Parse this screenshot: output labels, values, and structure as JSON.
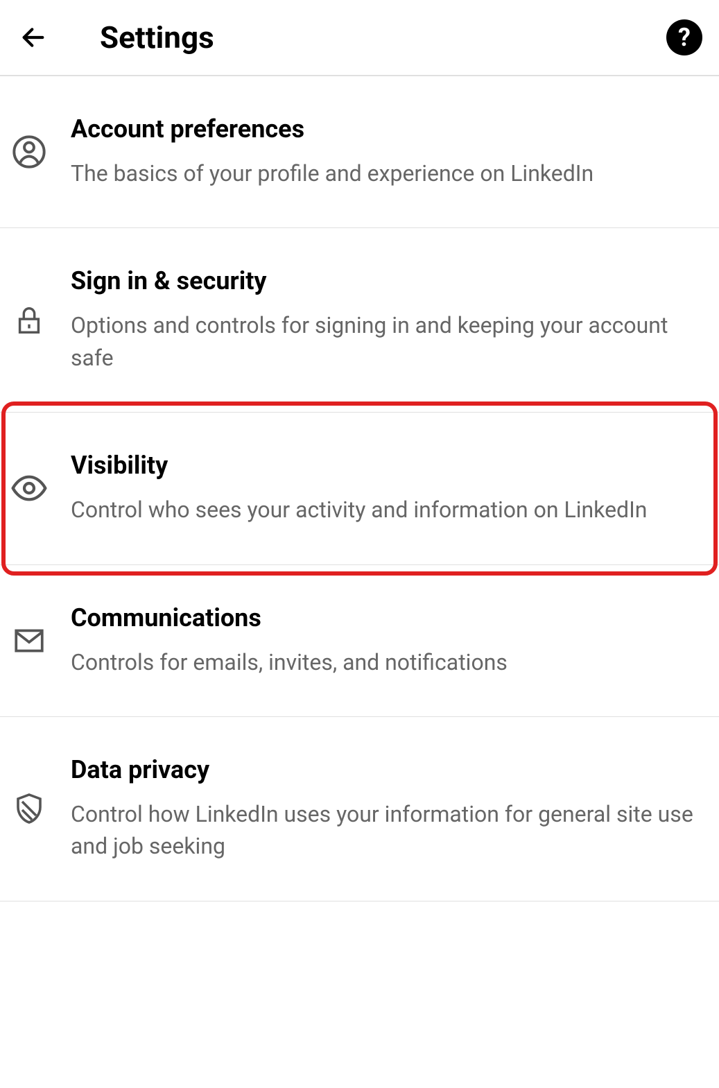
{
  "header": {
    "title": "Settings"
  },
  "items": [
    {
      "title": "Account preferences",
      "desc": "The basics of your profile and experience on LinkedIn"
    },
    {
      "title": "Sign in & security",
      "desc": "Options and controls for signing in and keeping your account safe"
    },
    {
      "title": "Visibility",
      "desc": "Control who sees your activity and information on LinkedIn"
    },
    {
      "title": "Communications",
      "desc": "Controls for emails, invites, and notifications"
    },
    {
      "title": "Data privacy",
      "desc": "Control how LinkedIn uses your information for general site use and job seeking"
    }
  ]
}
